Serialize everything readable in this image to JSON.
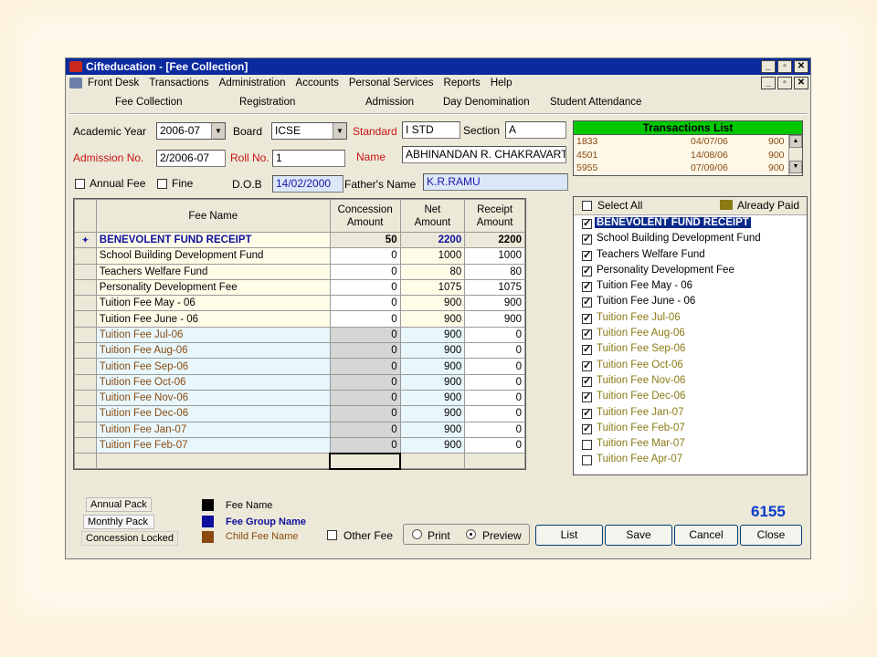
{
  "window": {
    "title": "Cifteducation - [Fee Collection]",
    "min_glyph": "_",
    "max_glyph": "▫",
    "close_glyph": "✕"
  },
  "menubar": {
    "items": [
      "Front Desk",
      "Transactions",
      "Administration",
      "Accounts",
      "Personal Services",
      "Reports",
      "Help"
    ]
  },
  "tabs": [
    "Fee Collection",
    "Registration",
    "Admission",
    "Day Denomination",
    "Student Attendance"
  ],
  "form": {
    "academic_year_label": "Academic Year",
    "academic_year": "2006-07",
    "board_label": "Board",
    "board": "ICSE",
    "standard_label": "Standard",
    "standard": "I STD",
    "section_label": "Section",
    "section": "A",
    "admission_no_label": "Admission No.",
    "admission_no": "2/2006-07",
    "roll_no_label": "Roll No.",
    "roll_no": "1",
    "name_label": "Name",
    "name": "ABHINANDAN R. CHAKRAVART",
    "annual_fee_label": "Annual Fee",
    "fine_label": "Fine",
    "dob_label": "D.O.B",
    "dob": "14/02/2000",
    "father_label": "Father's Name",
    "father": "K.R.RAMU"
  },
  "transactions": {
    "title": "Transactions List",
    "rows": [
      {
        "id": "1833",
        "date": "04/07/06",
        "amount": "900"
      },
      {
        "id": "4501",
        "date": "14/08/06",
        "amount": "900"
      },
      {
        "id": "5955",
        "date": "07/09/06",
        "amount": "900"
      }
    ]
  },
  "fee_table": {
    "headers": {
      "fee_name": "Fee Name",
      "concession": [
        "Concession",
        "Amount"
      ],
      "net": [
        "Net",
        "Amount"
      ],
      "receipt": [
        "Receipt",
        "Amount"
      ]
    },
    "rows": [
      {
        "marker": "✦",
        "name": "BENEVOLENT FUND RECEIPT",
        "concession": "50",
        "net": "2200",
        "receipt": "2200",
        "kind": "group"
      },
      {
        "marker": "",
        "name": "School Building Development Fund",
        "concession": "0",
        "net": "1000",
        "receipt": "1000",
        "kind": "fee"
      },
      {
        "marker": "",
        "name": "Teachers Welfare Fund",
        "concession": "0",
        "net": "80",
        "receipt": "80",
        "kind": "fee"
      },
      {
        "marker": "",
        "name": "Personality Development Fee",
        "concession": "0",
        "net": "1075",
        "receipt": "1075",
        "kind": "fee"
      },
      {
        "marker": "",
        "name": "Tuition Fee May - 06",
        "concession": "0",
        "net": "900",
        "receipt": "900",
        "kind": "fee"
      },
      {
        "marker": "",
        "name": "Tuition Fee June - 06",
        "concession": "0",
        "net": "900",
        "receipt": "900",
        "kind": "fee"
      },
      {
        "marker": "",
        "name": "Tuition Fee Jul-06",
        "concession": "0",
        "net": "900",
        "receipt": "0",
        "kind": "child"
      },
      {
        "marker": "",
        "name": "Tuition Fee Aug-06",
        "concession": "0",
        "net": "900",
        "receipt": "0",
        "kind": "child"
      },
      {
        "marker": "",
        "name": "Tuition Fee Sep-06",
        "concession": "0",
        "net": "900",
        "receipt": "0",
        "kind": "child"
      },
      {
        "marker": "",
        "name": "Tuition Fee Oct-06",
        "concession": "0",
        "net": "900",
        "receipt": "0",
        "kind": "child"
      },
      {
        "marker": "",
        "name": "Tuition Fee Nov-06",
        "concession": "0",
        "net": "900",
        "receipt": "0",
        "kind": "child"
      },
      {
        "marker": "",
        "name": "Tuition Fee Dec-06",
        "concession": "0",
        "net": "900",
        "receipt": "0",
        "kind": "child"
      },
      {
        "marker": "",
        "name": "Tuition Fee Jan-07",
        "concession": "0",
        "net": "900",
        "receipt": "0",
        "kind": "child"
      },
      {
        "marker": "",
        "name": "Tuition Fee Feb-07",
        "concession": "0",
        "net": "900",
        "receipt": "0",
        "kind": "child"
      }
    ]
  },
  "checklist": {
    "select_all_label": "Select All",
    "already_paid_label": "Already Paid",
    "already_paid_color": "#8a7a14",
    "items": [
      {
        "label": "BENEVOLENT FUND RECEIPT",
        "checked": true,
        "style": "highlight"
      },
      {
        "label": "School Building Development Fund",
        "checked": true,
        "style": "normal"
      },
      {
        "label": "Teachers Welfare Fund",
        "checked": true,
        "style": "normal"
      },
      {
        "label": "Personality Development Fee",
        "checked": true,
        "style": "normal"
      },
      {
        "label": "Tuition Fee May - 06",
        "checked": true,
        "style": "normal"
      },
      {
        "label": "Tuition Fee June - 06",
        "checked": true,
        "style": "normal"
      },
      {
        "label": "Tuition Fee Jul-06",
        "checked": true,
        "style": "paid"
      },
      {
        "label": "Tuition Fee Aug-06",
        "checked": true,
        "style": "paid"
      },
      {
        "label": "Tuition Fee Sep-06",
        "checked": true,
        "style": "paid"
      },
      {
        "label": "Tuition Fee Oct-06",
        "checked": true,
        "style": "paid"
      },
      {
        "label": "Tuition Fee Nov-06",
        "checked": true,
        "style": "paid"
      },
      {
        "label": "Tuition Fee Dec-06",
        "checked": true,
        "style": "paid"
      },
      {
        "label": "Tuition Fee Jan-07",
        "checked": true,
        "style": "paid"
      },
      {
        "label": "Tuition Fee Feb-07",
        "checked": true,
        "style": "paid"
      },
      {
        "label": "Tuition Fee Mar-07",
        "checked": false,
        "style": "paid"
      },
      {
        "label": "Tuition Fee Apr-07",
        "checked": false,
        "style": "paid"
      }
    ]
  },
  "footer": {
    "annual_pack": "Annual Pack",
    "monthly_pack": "Monthly Pack",
    "concession_locked": "Concession Locked",
    "legend": [
      {
        "label": "Fee Name",
        "color": "#000000"
      },
      {
        "label": "Fee Group Name",
        "color": "#10109c"
      },
      {
        "label": "Child Fee Name",
        "color": "#8a4a10"
      }
    ],
    "other_fee_label": "Other Fee",
    "print_label": "Print",
    "preview_label": "Preview",
    "total": "6155",
    "buttons": {
      "list": "List",
      "save": "Save",
      "cancel": "Cancel",
      "close": "Close"
    }
  }
}
